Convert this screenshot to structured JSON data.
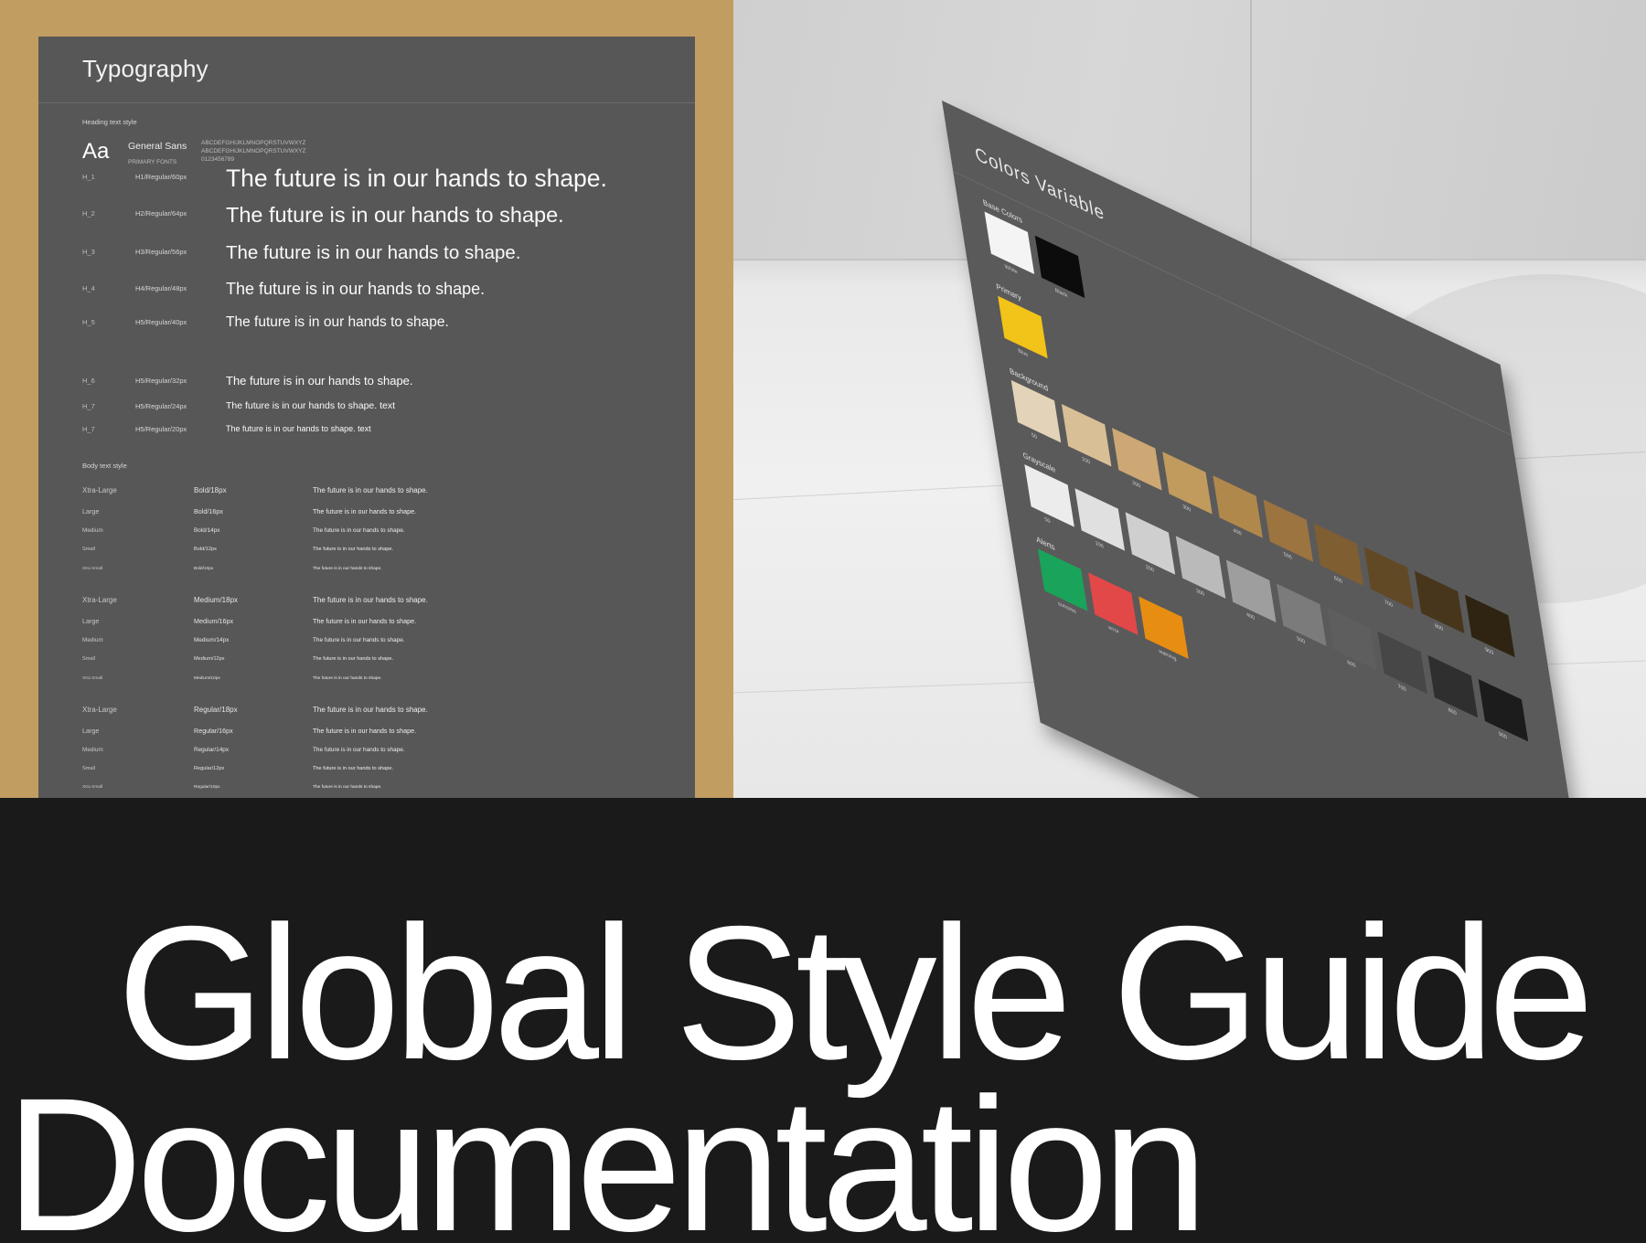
{
  "typography": {
    "title": "Typography",
    "heading_section_label": "Heading text style",
    "font": {
      "aa": "Aa",
      "name": "General Sans",
      "subtitle": "PRIMARY FONTS",
      "uppercase": "ABCDEFGHIJKLMNOPQRSTUVWXYZ",
      "lowercase": "ABCDEFGHIJKLMNOPQRSTUVWXYZ",
      "digits": "0123456789"
    },
    "headings": [
      {
        "tag": "H_1",
        "spec": "H1/Regular/60px",
        "sample": "The future is in our hands to shape."
      },
      {
        "tag": "H_2",
        "spec": "H2/Regular/64px",
        "sample": "The future is in our hands to shape."
      },
      {
        "tag": "H_3",
        "spec": "H3/Regular/56px",
        "sample": "The future is in our hands to shape."
      },
      {
        "tag": "H_4",
        "spec": "H4/Regular/48px",
        "sample": "The future is in our hands to shape."
      },
      {
        "tag": "H_5",
        "spec": "H5/Regular/40px",
        "sample": "The future is in our hands to shape."
      },
      {
        "tag": "H_6",
        "spec": "H5/Regular/32px",
        "sample": "The future is in our hands to shape."
      },
      {
        "tag": "H_7",
        "spec": "H5/Regular/24px",
        "sample": "The future is in our hands to shape.  text"
      },
      {
        "tag": "H_7",
        "spec": "H5/Regular/20px",
        "sample": "The future is in our hands to shape.  text"
      }
    ],
    "body_section_label": "Body text style",
    "body_groups": [
      {
        "rows": [
          {
            "size": "Xtra-Large",
            "spec": "Bold/18px",
            "sample": "The future is in our hands to shape."
          },
          {
            "size": "Large",
            "spec": "Bold/16px",
            "sample": "The future is in our hands to shape."
          },
          {
            "size": "Medium",
            "spec": "Bold/14px",
            "sample": "The future is in our hands to shape."
          },
          {
            "size": "Small",
            "spec": "Bold/12px",
            "sample": "The future is in our hands to shape."
          },
          {
            "size": "Xtra Small",
            "spec": "Bold/10px",
            "sample": "The future is in our hands to shape."
          }
        ]
      },
      {
        "rows": [
          {
            "size": "Xtra-Large",
            "spec": "Medium/18px",
            "sample": "The future is in our hands to shape."
          },
          {
            "size": "Large",
            "spec": "Medium/16px",
            "sample": "The future is in our hands to shape."
          },
          {
            "size": "Medium",
            "spec": "Medium/14px",
            "sample": "The future is in our hands to shape."
          },
          {
            "size": "Small",
            "spec": "Medium/12px",
            "sample": "The future is in our hands to shape."
          },
          {
            "size": "Xtra Small",
            "spec": "Medium/10px",
            "sample": "The future is in our hands to shape."
          }
        ]
      },
      {
        "rows": [
          {
            "size": "Xtra-Large",
            "spec": "Regular/18px",
            "sample": "The future is in our hands to shape."
          },
          {
            "size": "Large",
            "spec": "Regular/16px",
            "sample": "The future is in our hands to shape."
          },
          {
            "size": "Medium",
            "spec": "Regular/14px",
            "sample": "The future is in our hands to shape."
          },
          {
            "size": "Small",
            "spec": "Regular/12px",
            "sample": "The future is in our hands to shape."
          },
          {
            "size": "Xtra Small",
            "spec": "Regular/10px",
            "sample": "The future is in our hands to shape."
          }
        ]
      }
    ]
  },
  "colors_sheet": {
    "title": "Colors Variable",
    "base_label": "Base Colors",
    "primary_label": "Primary",
    "background_label": "Background",
    "grayscale_label": "Grayscale",
    "alerts_label": "Alerts",
    "base": [
      {
        "name": "White",
        "hex": "#f4f4f4"
      },
      {
        "name": "Black",
        "hex": "#0c0c0c"
      }
    ],
    "primary": [
      {
        "name": "Blue",
        "hex": "#f2c318"
      }
    ],
    "background": [
      {
        "name": "50",
        "hex": "#e3d3b8"
      },
      {
        "name": "100",
        "hex": "#d9bf96"
      },
      {
        "name": "200",
        "hex": "#cda874"
      },
      {
        "name": "300",
        "hex": "#c19a5e"
      },
      {
        "name": "400",
        "hex": "#b1884c"
      },
      {
        "name": "500",
        "hex": "#9c7440"
      },
      {
        "name": "600",
        "hex": "#7f5e32"
      },
      {
        "name": "700",
        "hex": "#624926"
      },
      {
        "name": "800",
        "hex": "#47361c"
      },
      {
        "name": "900",
        "hex": "#2f2412"
      }
    ],
    "grayscale": [
      {
        "name": "50",
        "hex": "#ececec"
      },
      {
        "name": "100",
        "hex": "#e0e0e0"
      },
      {
        "name": "200",
        "hex": "#cfcfcf"
      },
      {
        "name": "300",
        "hex": "#bababa"
      },
      {
        "name": "400",
        "hex": "#9e9e9e"
      },
      {
        "name": "500",
        "hex": "#7b7b7b"
      },
      {
        "name": "600",
        "hex": "#5e5e5e"
      },
      {
        "name": "700",
        "hex": "#474747"
      },
      {
        "name": "800",
        "hex": "#2f2f2f"
      },
      {
        "name": "900",
        "hex": "#1c1c1c"
      }
    ],
    "alerts": [
      {
        "name": "success",
        "hex": "#1aa35a"
      },
      {
        "name": "error",
        "hex": "#e24848"
      },
      {
        "name": "warning",
        "hex": "#e78d12"
      }
    ]
  },
  "headline": {
    "line1": "Global Style Guide",
    "line2": "Documentation"
  }
}
